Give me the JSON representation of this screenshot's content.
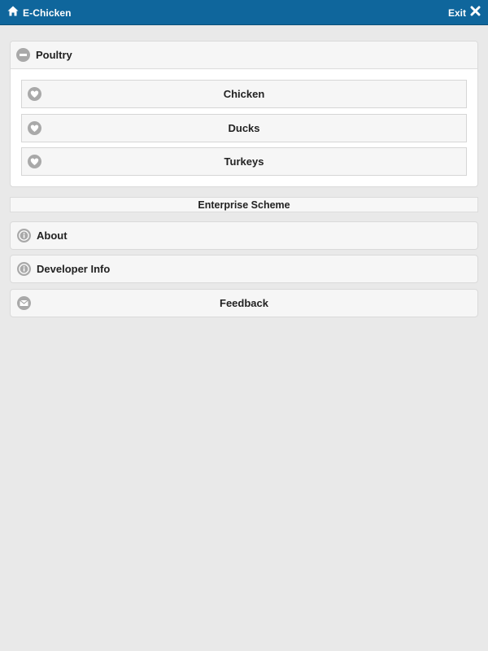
{
  "header": {
    "title": "E-Chicken",
    "home_icon": "home-icon",
    "exit_label": "Exit",
    "exit_icon": "close-icon",
    "bar_color": "#0f669c"
  },
  "poultry": {
    "label": "Poultry",
    "icon": "minus-icon",
    "items": [
      {
        "label": "Chicken",
        "icon": "heart-icon"
      },
      {
        "label": "Ducks",
        "icon": "heart-icon"
      },
      {
        "label": "Turkeys",
        "icon": "heart-icon"
      }
    ]
  },
  "enterprise": {
    "label": "Enterprise Scheme"
  },
  "menu": {
    "about": {
      "label": "About",
      "icon": "info-icon"
    },
    "developer": {
      "label": "Developer Info",
      "icon": "info-icon"
    },
    "feedback": {
      "label": "Feedback",
      "icon": "mail-icon"
    }
  }
}
